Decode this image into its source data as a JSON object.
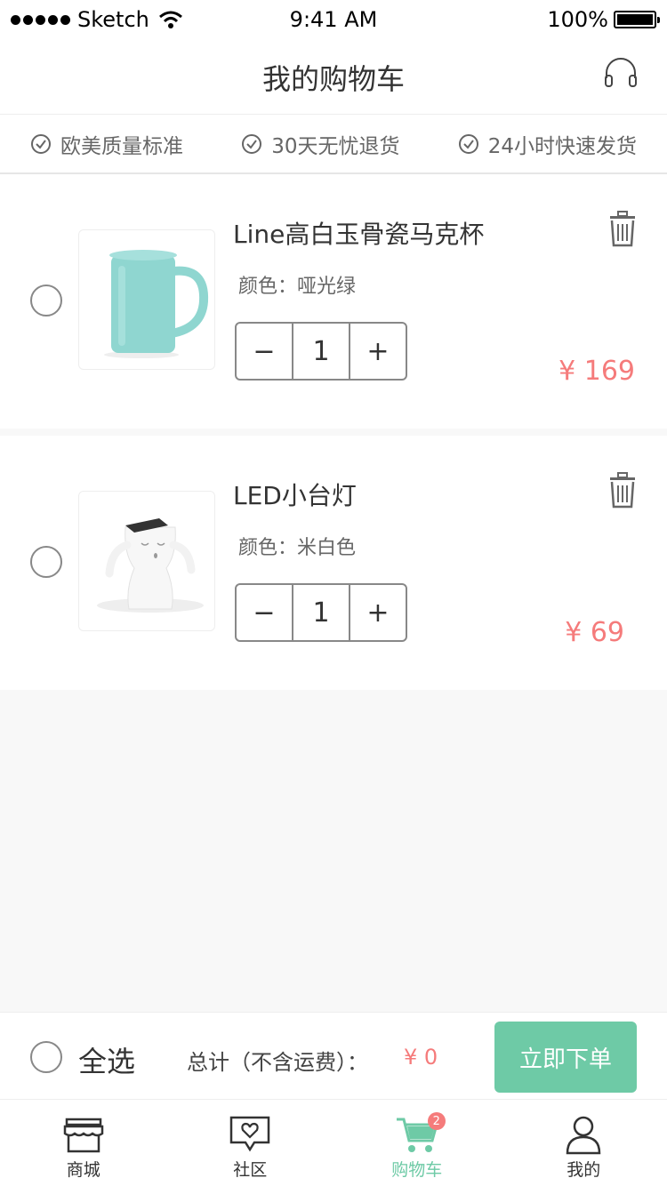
{
  "status_bar": {
    "carrier": "Sketch",
    "time": "9:41 AM",
    "battery": "100%"
  },
  "header": {
    "title": "我的购物车"
  },
  "guarantees": [
    "欧美质量标准",
    "30天无忧退货",
    "24小时快速发货"
  ],
  "items": [
    {
      "name": "Line高白玉骨瓷马克杯",
      "color_label": "颜色：",
      "color": "哑光绿",
      "quantity": "1",
      "price": "¥ 169"
    },
    {
      "name": "LED小台灯",
      "color_label": "颜色：",
      "color": "米白色",
      "quantity": "1",
      "price": "¥ 69"
    }
  ],
  "stepper": {
    "minus": "−",
    "plus": "+"
  },
  "checkout": {
    "select_all": "全选",
    "total_label": "总计（不含运费）：",
    "total": "¥ 0",
    "order_button": "立即下单"
  },
  "tabs": [
    {
      "label": "商城"
    },
    {
      "label": "社区"
    },
    {
      "label": "购物车",
      "badge": "2"
    },
    {
      "label": "我的"
    }
  ],
  "colors": {
    "accent": "#6ecaa6",
    "price": "#f57b7b"
  }
}
